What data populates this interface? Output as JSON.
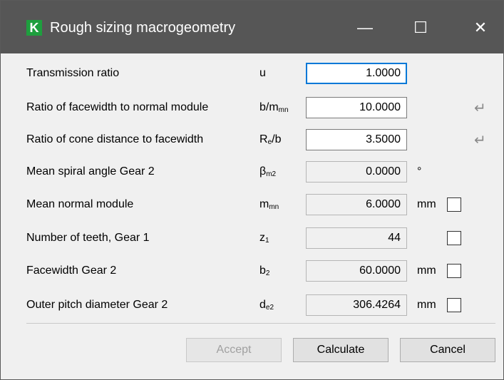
{
  "window": {
    "title": "Rough sizing macrogeometry",
    "icon_letter": "K"
  },
  "titlebar": {
    "minimize": "—",
    "maximize": "☐",
    "close": "✕"
  },
  "rows": [
    {
      "label": "Transmission ratio",
      "sym": "u",
      "sub": "",
      "value": "1.0000",
      "unit": "",
      "checkbox": false,
      "enter_icon": ""
    },
    {
      "label": "Ratio of facewidth to normal module",
      "sym": "b/m",
      "sub": "mn",
      "value": "10.0000",
      "unit": "",
      "checkbox": false,
      "enter_icon": "↵"
    },
    {
      "label": "Ratio of cone distance to facewidth",
      "sym": "R",
      "sub": "e",
      "sym2": "/b",
      "value": "3.5000",
      "unit": "",
      "checkbox": false,
      "enter_icon": "↵"
    },
    {
      "label": "Mean spiral angle Gear 2",
      "sym": "β",
      "sub": "m2",
      "value": "0.0000",
      "unit": "°",
      "checkbox": false,
      "enter_icon": ""
    },
    {
      "label": "Mean normal module",
      "sym": "m",
      "sub": "mn",
      "value": "6.0000",
      "unit": "mm",
      "checkbox": true,
      "enter_icon": ""
    },
    {
      "label": "Number of teeth, Gear 1",
      "sym": "z",
      "sub": "1",
      "value": "44",
      "unit": "",
      "checkbox": true,
      "enter_icon": ""
    },
    {
      "label": "Facewidth Gear 2",
      "sym": "b",
      "sub": "2",
      "value": "60.0000",
      "unit": "mm",
      "checkbox": true,
      "enter_icon": ""
    },
    {
      "label": "Outer pitch diameter Gear 2",
      "sym": "d",
      "sub": "e2",
      "value": "306.4264",
      "unit": "mm",
      "checkbox": true,
      "enter_icon": ""
    }
  ],
  "buttons": {
    "accept": "Accept",
    "calculate": "Calculate",
    "cancel": "Cancel"
  }
}
